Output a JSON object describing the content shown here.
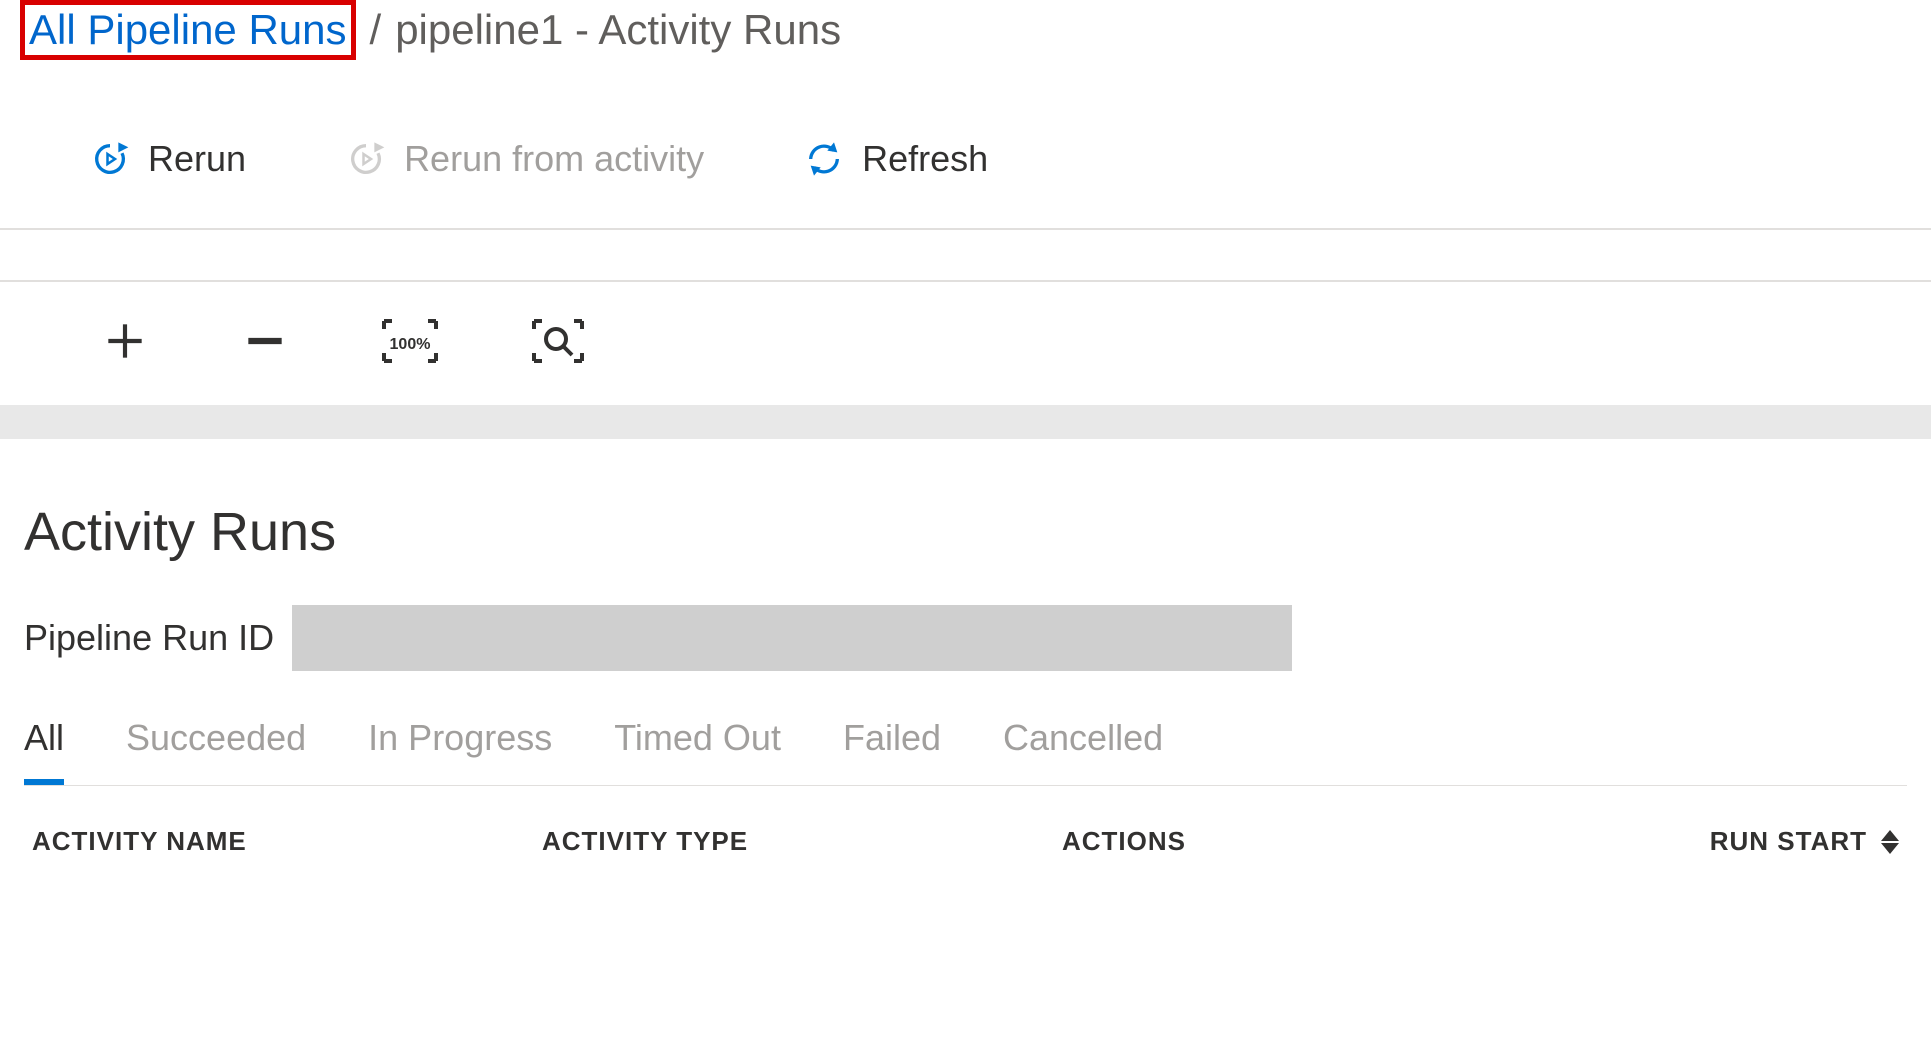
{
  "breadcrumb": {
    "link": "All Pipeline Runs",
    "separator": "/",
    "current": "pipeline1 - Activity Runs"
  },
  "toolbar": {
    "rerun": "Rerun",
    "rerun_activity": "Rerun from activity",
    "refresh": "Refresh"
  },
  "zoom": {
    "full_label": "100%"
  },
  "section": {
    "title": "Activity Runs",
    "run_id_label": "Pipeline Run ID",
    "run_id_value": ""
  },
  "filters": {
    "tabs": [
      "All",
      "Succeeded",
      "In Progress",
      "Timed Out",
      "Failed",
      "Cancelled"
    ],
    "active": "All"
  },
  "table": {
    "columns": {
      "activity_name": "ACTIVITY NAME",
      "activity_type": "ACTIVITY TYPE",
      "actions": "ACTIONS",
      "run_start": "RUN START"
    },
    "rows": []
  }
}
